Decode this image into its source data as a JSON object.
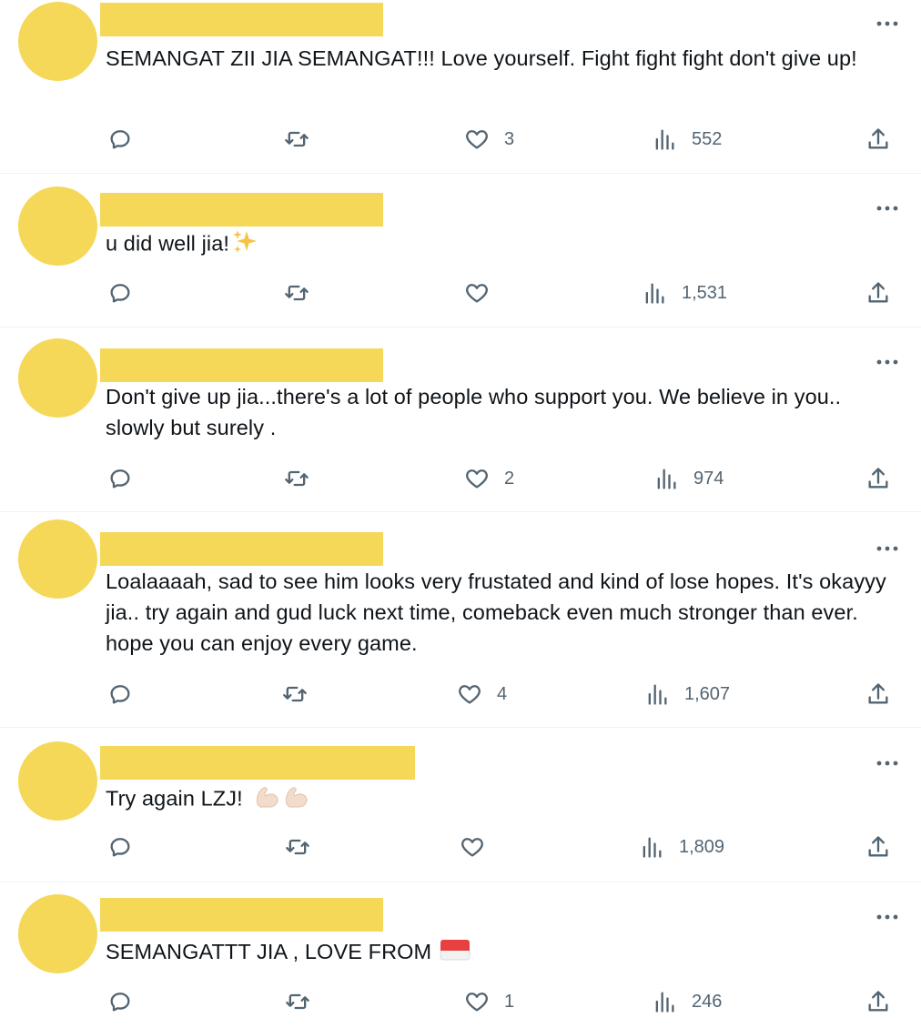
{
  "tweets": [
    {
      "text": "SEMANGAT ZII JIA SEMANGAT!!! Love yourself. Fight fight fight don't give up!",
      "emoji": "",
      "likes": "3",
      "views": "552"
    },
    {
      "text": "u did well jia!",
      "emoji": "sparkles",
      "likes": "",
      "views": "1,531"
    },
    {
      "text": "Don't give up jia...there's a lot of people who support you. We believe in you.. slowly but surely .",
      "emoji": "",
      "likes": "2",
      "views": "974"
    },
    {
      "text": "Loalaaaah, sad to see him looks very frustated and kind of lose hopes. It's okayyy jia.. try again and gud luck next time, comeback even much stronger than ever. hope you can enjoy every game.",
      "emoji": "",
      "likes": "4",
      "views": "1,607"
    },
    {
      "text": "Try again LZJ! ",
      "emoji": "flexed-biceps",
      "likes": "",
      "views": "1,809"
    },
    {
      "text": "SEMANGATTT JIA , LOVE FROM ",
      "emoji": "flag-indonesia",
      "likes": "1",
      "views": "246"
    }
  ],
  "colors": {
    "redaction": "#f5d858",
    "icon": "#536471",
    "divider": "#eff3f4",
    "text": "#0f1419"
  },
  "icons": {
    "reply": "reply-icon",
    "retweet": "retweet-icon",
    "like": "heart-icon",
    "views": "views-icon",
    "share": "share-icon",
    "more": "more-icon"
  }
}
